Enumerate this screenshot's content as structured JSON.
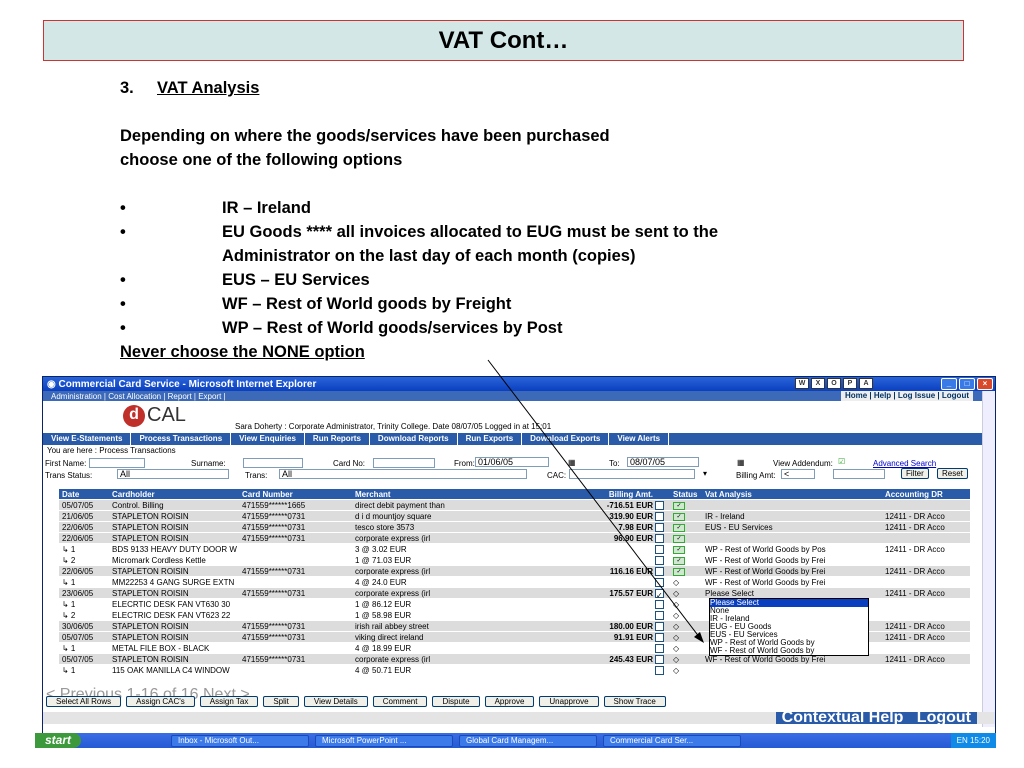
{
  "slide": {
    "title": "VAT Cont…",
    "heading_num": "3.",
    "heading": "VAT Analysis",
    "intro1": "Depending on where the goods/services have been purchased",
    "intro2": "choose one of the following options",
    "bullet": "•",
    "b1": "IR – Ireland",
    "b2a": "EU Goods **** all invoices allocated to EUG must be sent to the",
    "b2b": "Administrator on the last day of each month (copies)",
    "b3": "EUS – EU Services",
    "b4": "WF – Rest of World goods by Freight",
    "b5": "WP – Rest of World goods/services by Post",
    "never": "Never choose the NONE option"
  },
  "ie": {
    "title": "Commercial Card Service - Microsoft Internet Explorer",
    "menu": "Administration | Cost Allocation | Report | Export |",
    "menu_right": "Home | Help | Log Issue | Logout",
    "logo_d": "d",
    "logo_cal": "CAL",
    "userline": "Sara Doherty : Corporate Administrator, Trinity College. Date 08/07/05 Logged in at 15:01",
    "nav": [
      "View E-Statements",
      "Process Transactions",
      "View Enquiries",
      "Run Reports",
      "Download Reports",
      "Run Exports",
      "Download Exports",
      "View Alerts"
    ],
    "you_are_here": "You are here : Process Transactions",
    "filters": {
      "first_name": "First Name:",
      "surname": "Surname:",
      "card_no": "Card No:",
      "from": "From:",
      "from_val": "01/06/05",
      "to": "To:",
      "to_val": "08/07/05",
      "view_addendum": "View Addendum:",
      "advanced": "Advanced Search",
      "trans_status": "Trans Status:",
      "trans_status_val": "All",
      "trans": "Trans:",
      "trans_val": "All",
      "cac": "CAC:",
      "billing_amt": "Billing Amt:",
      "billing_op": "<",
      "filter": "Filter",
      "reset": "Reset"
    },
    "columns": [
      "Date",
      "Cardholder",
      "Card Number",
      "Merchant",
      "Billing Amt.",
      "",
      "Status",
      "Vat Analysis",
      "Accounting DR"
    ],
    "rows": [
      [
        "05/07/05",
        "Control. Billing",
        "471559******1665",
        "direct debit payment than",
        "-716.51 EUR",
        "",
        "",
        "",
        ""
      ],
      [
        "21/06/05",
        "STAPLETON ROISIN",
        "471559******0731",
        "d i d mountjoy square",
        "319.90 EUR",
        "",
        "",
        "IR - Ireland",
        "12411 - DR Acco"
      ],
      [
        "22/06/05",
        "STAPLETON ROISIN",
        "471559******0731",
        "tesco store 3573",
        "7.98 EUR",
        "",
        "",
        "EUS - EU Services",
        "12411 - DR Acco"
      ],
      [
        "22/06/05",
        "STAPLETON ROISIN",
        "471559******0731",
        "corporate express (irl",
        "96.90 EUR",
        "",
        "",
        "",
        ""
      ],
      [
        "↳ 1",
        "BDS 9133 HEAVY DUTY DOOR W",
        "",
        "3 @ 3.02 EUR",
        "",
        "",
        "",
        "WP - Rest of World Goods by Pos",
        "12411 - DR Acco"
      ],
      [
        "↳ 2",
        "Micromark Cordless Kettle",
        "",
        "1 @ 71.03 EUR",
        "",
        "",
        "",
        "WF - Rest of World Goods by Frei",
        ""
      ],
      [
        "22/06/05",
        "STAPLETON ROISIN",
        "471559******0731",
        "corporate express (irl",
        "116.16 EUR",
        "",
        "",
        "WF - Rest of World Goods by Frei",
        "12411 - DR Acco"
      ],
      [
        "↳ 1",
        "MM22253 4 GANG SURGE EXTN",
        "",
        "4 @ 24.0 EUR",
        "",
        "",
        "",
        "WF - Rest of World Goods by Frei",
        ""
      ],
      [
        "23/06/05",
        "STAPLETON ROISIN",
        "471559******0731",
        "corporate express (irl",
        "175.57 EUR",
        "",
        "",
        "Please Select",
        "12411 - DR Acco"
      ],
      [
        "↳ 1",
        "ELECRTIC DESK FAN VT630 30",
        "",
        "1 @ 86.12 EUR",
        "",
        "",
        "",
        "",
        ""
      ],
      [
        "↳ 2",
        "ELECTRIC DESK FAN VT623 22",
        "",
        "1 @ 58.98 EUR",
        "",
        "",
        "",
        "",
        ""
      ],
      [
        "30/06/05",
        "STAPLETON ROISIN",
        "471559******0731",
        "irish rail abbey street",
        "180.00 EUR",
        "",
        "",
        "",
        "12411 - DR Acco"
      ],
      [
        "05/07/05",
        "STAPLETON ROISIN",
        "471559******0731",
        "viking direct ireland",
        "91.91 EUR",
        "",
        "",
        "",
        "12411 - DR Acco"
      ],
      [
        "↳ 1",
        "METAL FILE BOX - BLACK",
        "",
        "4 @ 18.99 EUR",
        "",
        "",
        "",
        "",
        ""
      ],
      [
        "05/07/05",
        "STAPLETON ROISIN",
        "471559******0731",
        "corporate express (irl",
        "245.43 EUR",
        "",
        "",
        "WF - Rest of World Goods by Frei",
        "12411 - DR Acco"
      ],
      [
        "↳ 1",
        "115 OAK MANILLA C4 WINDOW",
        "",
        "4 @ 50.71 EUR",
        "",
        "",
        "",
        "",
        ""
      ]
    ],
    "dropdown": [
      "Please Select",
      "None",
      "IR - Ireland",
      "EUG - EU Goods",
      "EUS - EU Services",
      "WP - Rest of World Goods by",
      "WF - Rest of World Goods by"
    ],
    "pager": "< Previous 1-16 of 16 Next >",
    "actions": [
      "Select All Rows",
      "Assign CAC's",
      "Assign Tax",
      "Split",
      "View Details",
      "Comment",
      "Dispute",
      "Approve",
      "Unapprove",
      "Show Trace"
    ],
    "contextual_help": "Contextual Help",
    "logout": "Logout"
  },
  "taskbar": {
    "start": "start",
    "tasks": [
      "Inbox - Microsoft Out...",
      "Microsoft PowerPoint ...",
      "Global Card Managem...",
      "Commercial Card Ser..."
    ],
    "tray": "EN  15:20"
  }
}
